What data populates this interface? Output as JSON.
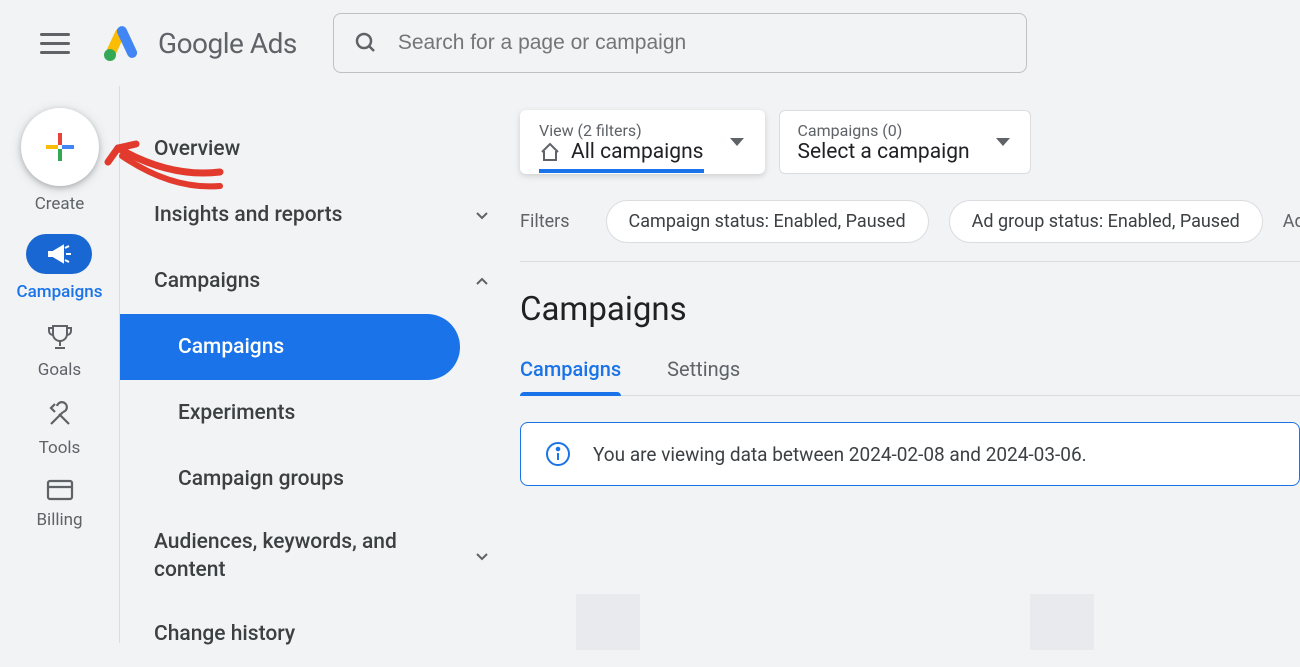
{
  "header": {
    "product_name": "Google Ads",
    "search_placeholder": "Search for a page or campaign"
  },
  "leftrail": {
    "create": "Create",
    "campaigns": "Campaigns",
    "goals": "Goals",
    "tools": "Tools",
    "billing": "Billing"
  },
  "nav": {
    "overview": "Overview",
    "insights": "Insights and reports",
    "campaigns": "Campaigns",
    "sub_campaigns": "Campaigns",
    "experiments": "Experiments",
    "campaign_groups": "Campaign groups",
    "audiences": "Audiences, keywords, and content",
    "change_history": "Change history"
  },
  "selectors": {
    "view_top": "View (2 filters)",
    "view_bot": "All campaigns",
    "camp_top": "Campaigns (0)",
    "camp_bot": "Select a campaign"
  },
  "filters": {
    "label": "Filters",
    "chip1": "Campaign status: Enabled, Paused",
    "chip2": "Ad group status: Enabled, Paused",
    "add": "Add fi"
  },
  "page": {
    "title": "Campaigns"
  },
  "tabs": {
    "campaigns": "Campaigns",
    "settings": "Settings"
  },
  "info": {
    "message": "You are viewing data between 2024-02-08 and 2024-03-06."
  }
}
